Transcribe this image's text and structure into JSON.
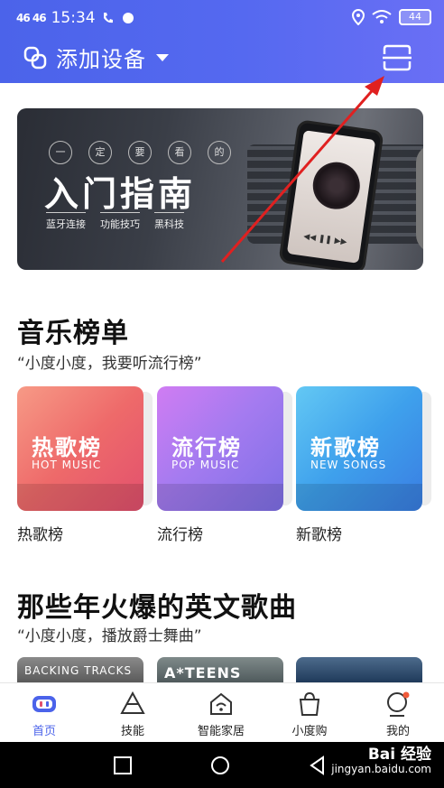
{
  "status": {
    "signal": "46 46",
    "time": "15:34",
    "battery": "44"
  },
  "header": {
    "add_device_label": "添加设备"
  },
  "banner": {
    "chars": [
      "一",
      "定",
      "要",
      "看",
      "的"
    ],
    "title": "入门指南",
    "tags": [
      "蓝牙连接",
      "功能技巧",
      "黑科技"
    ]
  },
  "music_chart": {
    "title": "音乐榜单",
    "subtitle": "“小度小度，我要听流行榜”",
    "cards": [
      {
        "cn": "热歌榜",
        "en": "HOT MUSIC",
        "label": "热歌榜"
      },
      {
        "cn": "流行榜",
        "en": "POP MUSIC",
        "label": "流行榜"
      },
      {
        "cn": "新歌榜",
        "en": "NEW SONGS",
        "label": "新歌榜"
      }
    ]
  },
  "english_songs": {
    "title": "那些年火爆的英文歌曲",
    "subtitle": "“小度小度，播放爵士舞曲”",
    "thumbs": [
      "BACKING TRACKS",
      "A*TEENS",
      ""
    ]
  },
  "tabs": [
    {
      "label": "首页",
      "icon": "home-icon"
    },
    {
      "label": "技能",
      "icon": "skills-icon"
    },
    {
      "label": "智能家居",
      "icon": "smart-home-icon"
    },
    {
      "label": "小度购",
      "icon": "shopping-bag-icon"
    },
    {
      "label": "我的",
      "icon": "profile-icon"
    }
  ],
  "watermark": {
    "brand": "Bai 经验",
    "url": "jingyan.baidu.com"
  },
  "colors": {
    "primary": "#4b63ea",
    "hot": "#ee6a6a",
    "pop": "#a57bf0",
    "new": "#3ea0ec"
  }
}
